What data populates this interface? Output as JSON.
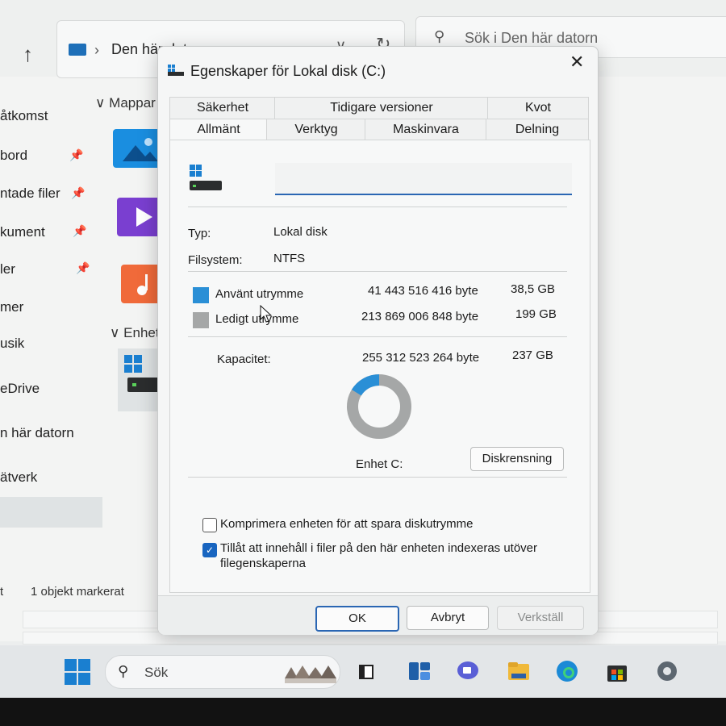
{
  "explorer": {
    "address_path": "Den här datorn",
    "search_placeholder": "Sök i Den här datorn",
    "sidebar": [
      {
        "label": "åtkomst"
      },
      {
        "label": "bord"
      },
      {
        "label": "ntade filer"
      },
      {
        "label": "kument"
      },
      {
        "label": "ler"
      },
      {
        "label": "mer"
      },
      {
        "label": "usik"
      },
      {
        "label": "eDrive"
      },
      {
        "label": "n här datorn"
      },
      {
        "label": "ätverk"
      }
    ],
    "group_folders": "Mappar",
    "group_devices": "Enheter",
    "status": {
      "count": "t",
      "selected": "1 objekt markerat"
    }
  },
  "dialog": {
    "title": "Egenskaper för Lokal disk (C:)",
    "tabs_top": [
      "Säkerhet",
      "Tidigare versioner",
      "Kvot"
    ],
    "tabs_bottom": [
      "Allmänt",
      "Verktyg",
      "Maskinvara",
      "Delning"
    ],
    "name_value": "",
    "type_label": "Typ:",
    "type_value": "Lokal disk",
    "fs_label": "Filsystem:",
    "fs_value": "NTFS",
    "used": {
      "label": "Använt utrymme",
      "bytes": "41 443 516 416 byte",
      "gb": "38,5 GB",
      "fraction": 0.162
    },
    "free": {
      "label": "Ledigt utrymme",
      "bytes": "213 869 006 848 byte",
      "gb": "199 GB"
    },
    "capacity": {
      "label": "Kapacitet:",
      "bytes": "255 312 523 264 byte",
      "gb": "237 GB"
    },
    "drive_label": "Enhet C:",
    "cleanup_button": "Diskrensning",
    "compress_label": "Komprimera enheten för att spara diskutrymme",
    "compress_checked": false,
    "index_label_1": "Tillåt att innehåll i filer på den här enheten indexeras utöver",
    "index_label_2": "filegenskaperna",
    "index_checked": true,
    "ok_button": "OK",
    "cancel_button": "Avbryt",
    "apply_button": "Verkställ",
    "colors": {
      "used": "#2a8fd6",
      "free": "#a5a7a7"
    }
  },
  "taskbar": {
    "search_label": "Sök",
    "icons": [
      "widgets-icon",
      "task-view-icon",
      "teams-chat-icon",
      "file-explorer-icon",
      "edge-icon",
      "store-icon",
      "settings-icon"
    ]
  }
}
